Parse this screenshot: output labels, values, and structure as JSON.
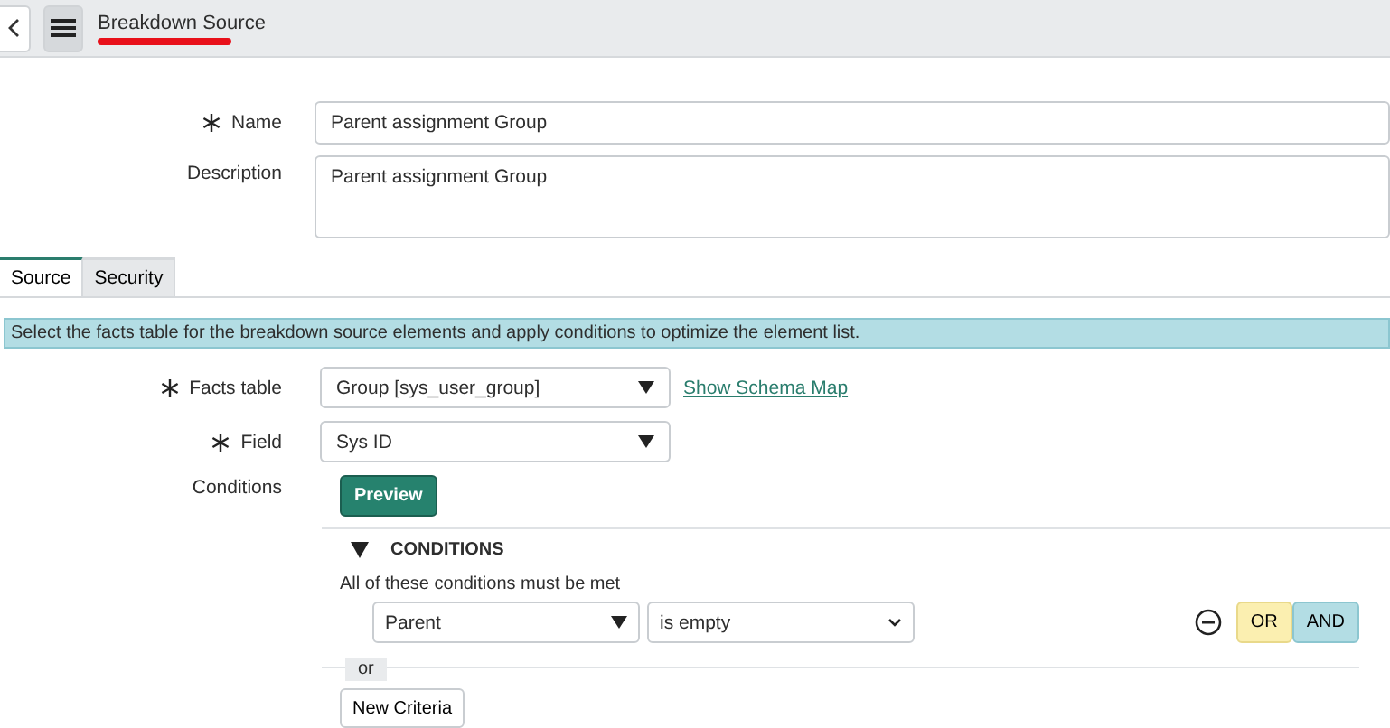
{
  "header": {
    "title": "Breakdown Source",
    "subtitle_redacted": true
  },
  "name_field": {
    "label": "Name",
    "required": true,
    "value": "Parent assignment Group"
  },
  "description_field": {
    "label": "Description",
    "required": false,
    "value": "Parent assignment Group"
  },
  "tabs": [
    {
      "label": "Source",
      "selected": true
    },
    {
      "label": "Security",
      "selected": false
    }
  ],
  "info_message": "Select the facts table for the breakdown source elements and apply conditions to optimize the element list.",
  "facts_table": {
    "label": "Facts table",
    "required": true,
    "value": "Group [sys_user_group]",
    "link": "Show Schema Map"
  },
  "field": {
    "label": "Field",
    "required": true,
    "value": "Sys ID"
  },
  "conditions": {
    "label": "Conditions",
    "preview_button": "Preview",
    "section_title": "CONDITIONS",
    "expanded": true,
    "rule": "All of these conditions must be met",
    "rows": [
      {
        "field": "Parent",
        "operator": "is empty"
      }
    ],
    "or_button": "OR",
    "and_button": "AND",
    "or_separator": "or",
    "new_criteria_button": "New Criteria"
  }
}
